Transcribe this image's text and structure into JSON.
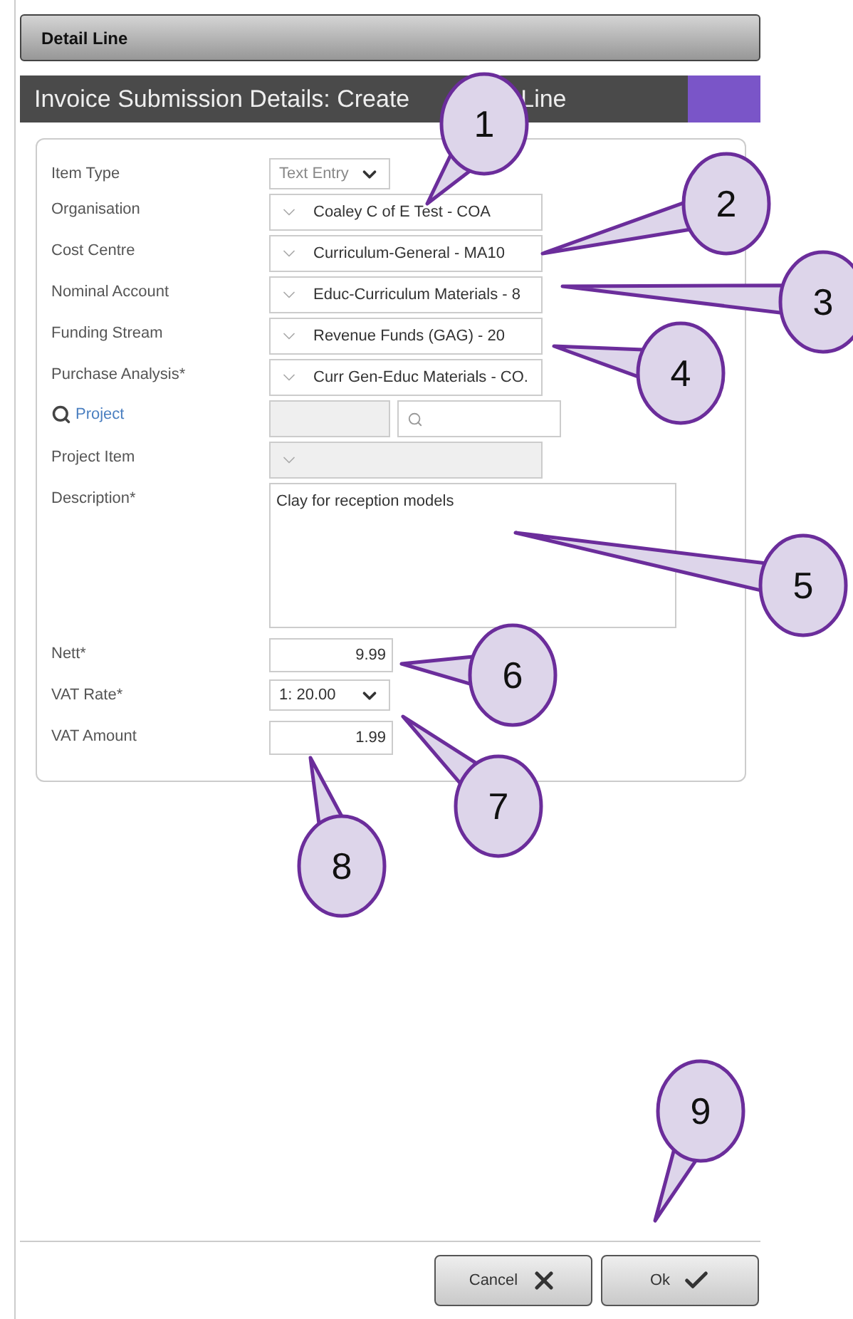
{
  "header": {
    "title": "Detail Line"
  },
  "title_bar": {
    "parts": [
      "Invoice Submission Details: Create",
      "Line"
    ]
  },
  "form": {
    "rows": [
      {
        "label": "Item Type",
        "kind": "dropdown",
        "value": "Text Entry",
        "disabled": true
      },
      {
        "label": "Organisation",
        "kind": "select",
        "value": "Coaley C of E  Test - COA",
        "disabled": false
      },
      {
        "label": "Cost Centre",
        "kind": "select",
        "value": "Curriculum-General - MA10",
        "disabled": false
      },
      {
        "label": "Nominal Account",
        "kind": "select",
        "value": "Educ-Curriculum Materials - 8",
        "disabled": false
      },
      {
        "label": "Funding Stream",
        "kind": "select",
        "value": "Revenue Funds (GAG) - 20",
        "disabled": false
      },
      {
        "label": "Purchase Analysis*",
        "kind": "select",
        "value": "Curr Gen-Educ Materials - CO.",
        "disabled": false
      },
      {
        "label": "Project",
        "kind": "lookup",
        "disabled": true
      },
      {
        "label": "Project Item",
        "kind": "select",
        "disabled": true
      },
      {
        "label": "Description*",
        "kind": "textarea",
        "value": "Clay for reception models",
        "disabled": false
      },
      {
        "label": "Nett*",
        "kind": "number",
        "value": "9.99",
        "disabled": false
      },
      {
        "label": "VAT Rate*",
        "kind": "dropdown",
        "value": "1: 20.00",
        "disabled": false
      },
      {
        "label": "VAT Amount",
        "kind": "number",
        "value": "1.99",
        "disabled": false
      }
    ]
  },
  "buttons": [
    {
      "label": "Cancel",
      "kind": "cancel"
    },
    {
      "label": "Ok",
      "kind": "ok"
    }
  ],
  "callouts": [
    {
      "number": "1"
    },
    {
      "number": "2"
    },
    {
      "number": "3"
    },
    {
      "number": "4"
    },
    {
      "number": "5"
    },
    {
      "number": "6"
    },
    {
      "number": "7"
    },
    {
      "number": "8"
    },
    {
      "number": "9"
    }
  ]
}
